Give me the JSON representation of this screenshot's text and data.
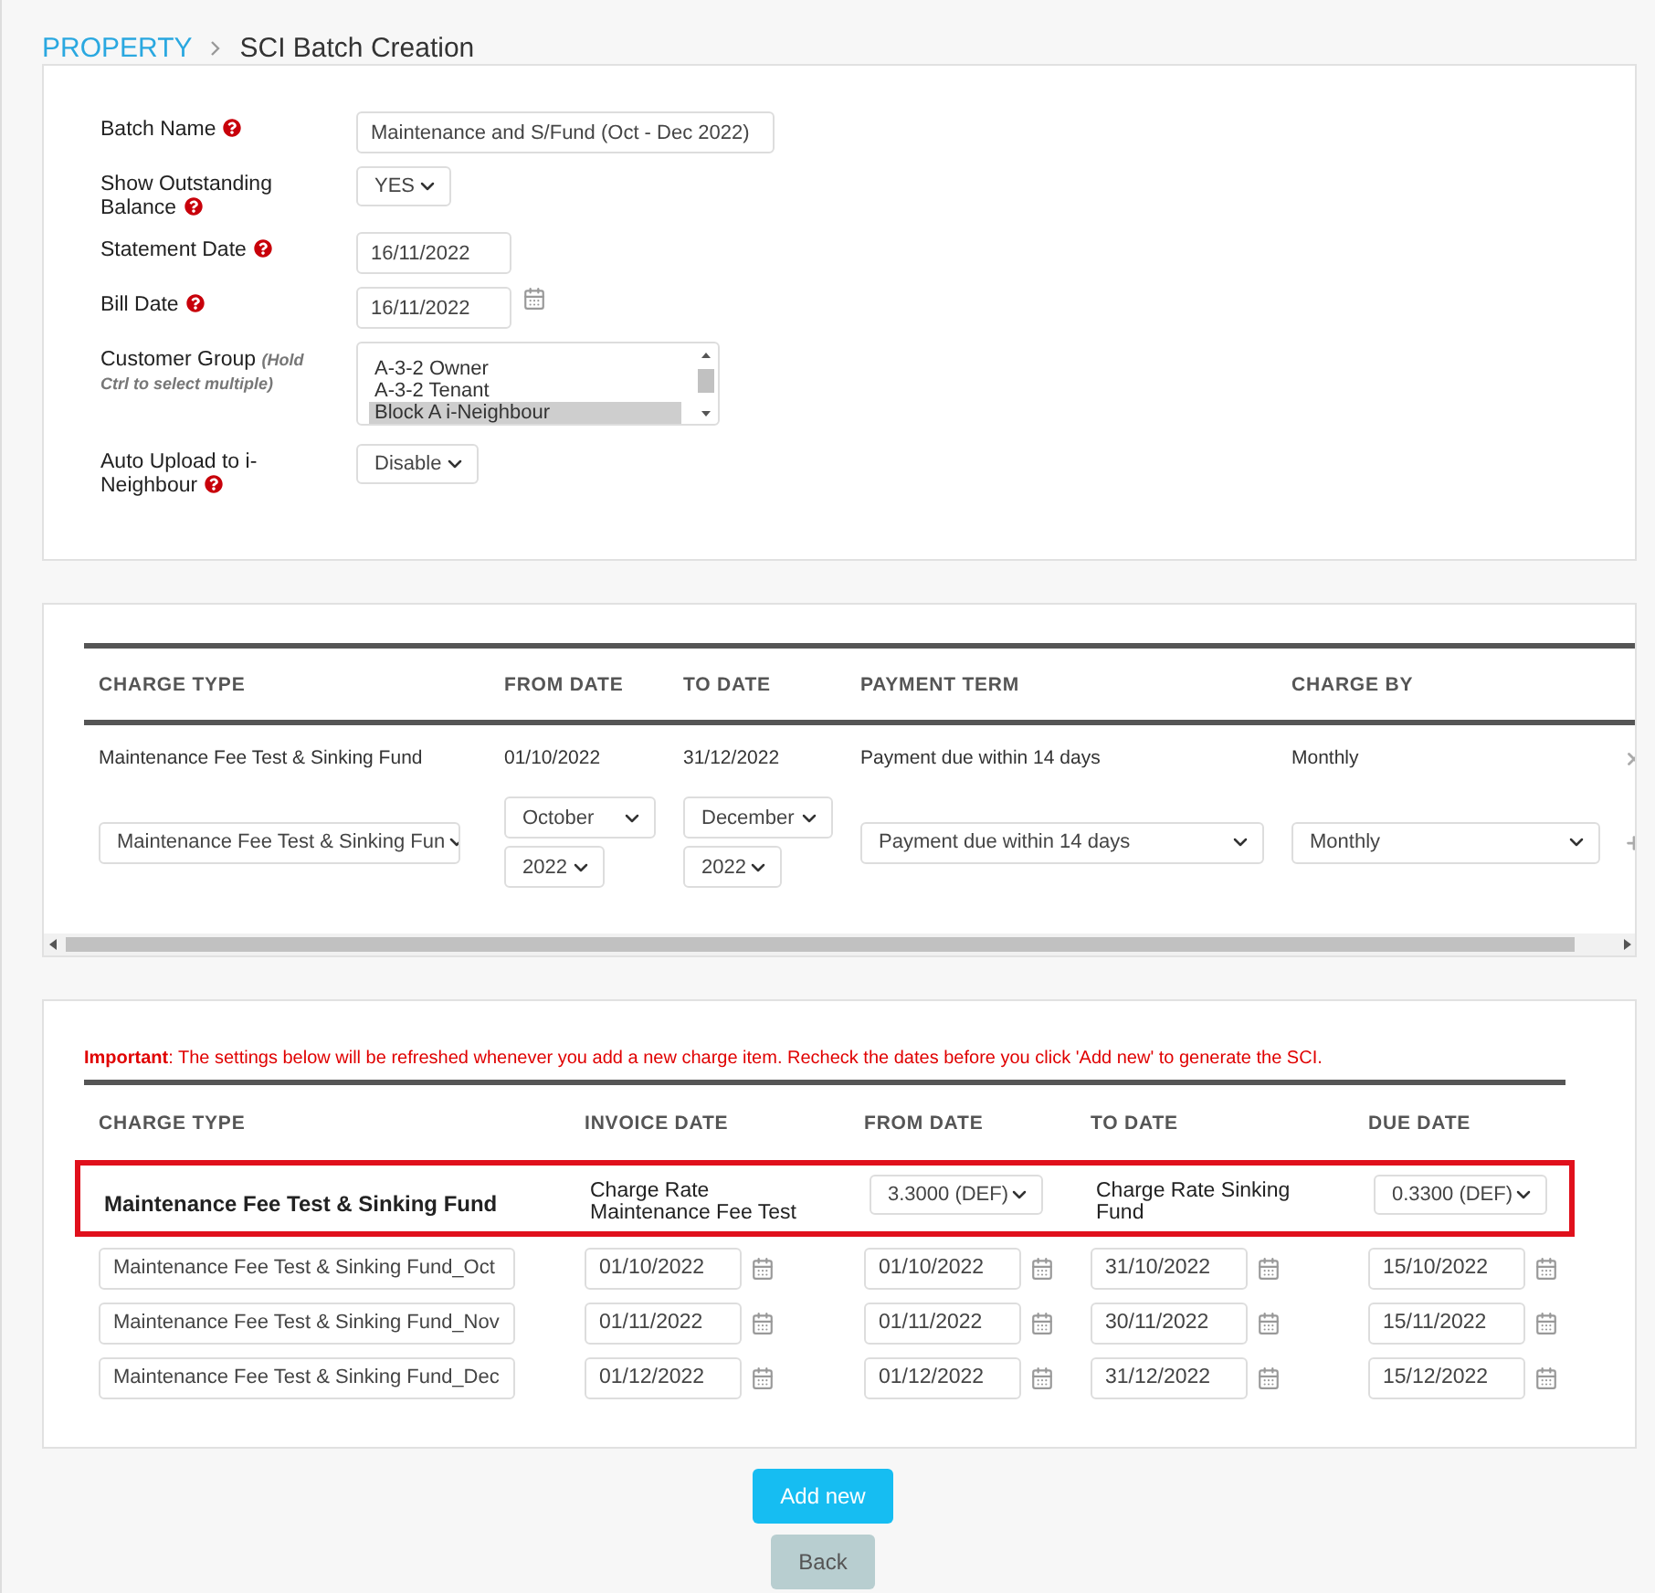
{
  "breadcrumb": {
    "parent": "PROPERTY",
    "current": "SCI Batch Creation"
  },
  "form": {
    "fields": [
      {
        "kind": "text",
        "label": "Batch Name",
        "help": true,
        "value": "Maintenance and S/Fund (Oct - Dec 2022)"
      },
      {
        "kind": "select",
        "label": "Show Outstanding Balance",
        "help": true,
        "value": "YES"
      },
      {
        "kind": "text",
        "label": "Statement Date",
        "help": true,
        "value": "16/11/2022"
      },
      {
        "kind": "date",
        "label": "Bill Date",
        "help": true,
        "value": "16/11/2022"
      },
      {
        "kind": "list",
        "label": "Customer Group",
        "hint": "(Hold Ctrl to select multiple)",
        "help": false,
        "options": [
          {
            "label": "A-3-2 Owner",
            "selected": false
          },
          {
            "label": "A-3-2 Tenant",
            "selected": false
          },
          {
            "label": "Block A i-Neighbour",
            "selected": true
          }
        ]
      },
      {
        "kind": "select",
        "label": "Auto Upload to i-Neighbour",
        "help": true,
        "value": "Disable"
      }
    ]
  },
  "charges": {
    "columns": [
      "CHARGE TYPE",
      "FROM DATE",
      "TO DATE",
      "PAYMENT TERM",
      "CHARGE BY"
    ],
    "rows": [
      {
        "charge_type": "Maintenance Fee Test & Sinking Fund",
        "from_date": "01/10/2022",
        "to_date": "31/12/2022",
        "payment_term": "Payment due within 14 days",
        "charge_by": "Monthly"
      }
    ],
    "editor": {
      "charge_type": "Maintenance Fee Test & Sinking Fun",
      "from_month": "October",
      "from_year": "2022",
      "to_month": "December",
      "to_year": "2022",
      "payment_term": "Payment due within 14 days",
      "charge_by": "Monthly"
    }
  },
  "schedule": {
    "notice": "**Important**: The settings below will be refreshed whenever you add a new charge item. Recheck the dates before you click 'Add new' to generate the SCI.",
    "columns": [
      "CHARGE TYPE",
      "INVOICE DATE",
      "FROM DATE",
      "TO DATE",
      "DUE DATE"
    ],
    "summary": {
      "charge_type": "Maintenance Fee Test & Sinking Fund",
      "rate_label_1": "Charge Rate Maintenance Fee Test",
      "rate_1": "3.3000 (DEF)",
      "rate_label_2": "Charge Rate Sinking Fund",
      "rate_2": "0.3300 (DEF)"
    },
    "rows": [
      {
        "name": "Maintenance Fee Test & Sinking Fund_Oct",
        "invoice_date": "01/10/2022",
        "from_date": "01/10/2022",
        "to_date": "31/10/2022",
        "due_date": "15/10/2022"
      },
      {
        "name": "Maintenance Fee Test & Sinking Fund_Nov",
        "invoice_date": "01/11/2022",
        "from_date": "01/11/2022",
        "to_date": "30/11/2022",
        "due_date": "15/11/2022"
      },
      {
        "name": "Maintenance Fee Test & Sinking Fund_Dec",
        "invoice_date": "01/12/2022",
        "from_date": "01/12/2022",
        "to_date": "31/12/2022",
        "due_date": "15/12/2022"
      }
    ]
  },
  "actions": [
    {
      "kind": "primary",
      "label": "Add new"
    },
    {
      "kind": "secondary",
      "label": "Back"
    }
  ]
}
